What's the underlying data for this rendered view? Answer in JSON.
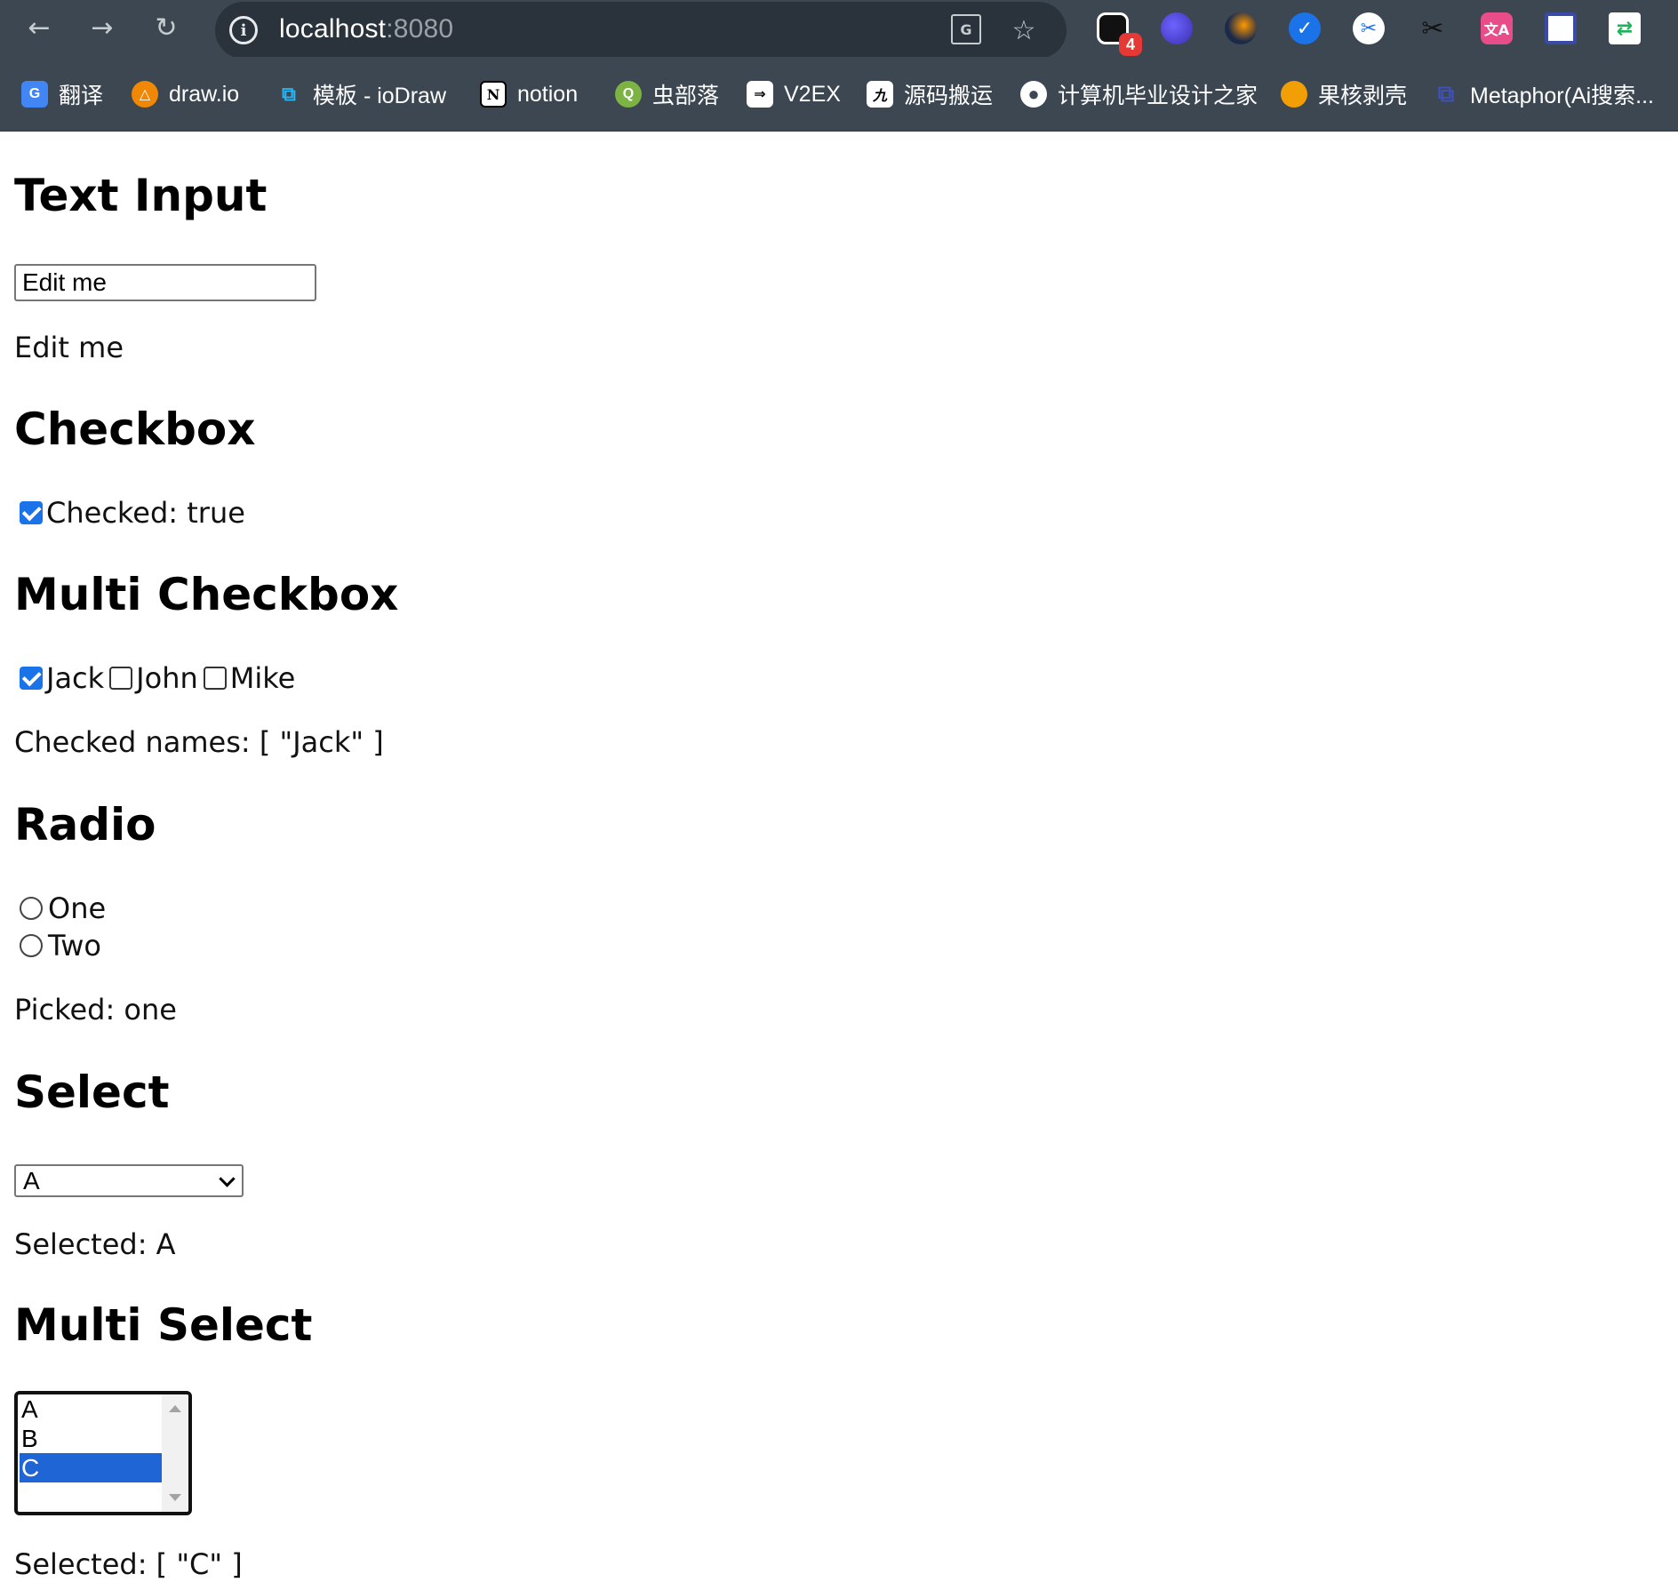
{
  "browser": {
    "url_host": "localhost",
    "url_port": ":8080",
    "extensions": [
      {
        "icon": "dark-circle-ext-icon",
        "badge": "4"
      },
      {
        "icon": "purple-swirl-ext-icon"
      },
      {
        "icon": "orange-swirl-ext-icon"
      },
      {
        "icon": "blue-check-ext-icon"
      },
      {
        "icon": "scissors-ext-icon"
      },
      {
        "icon": "cut-ext-icon"
      },
      {
        "icon": "translate-ext-icon"
      },
      {
        "icon": "window-ext-icon"
      },
      {
        "icon": "green-link-ext-icon"
      }
    ],
    "bookmarks": [
      {
        "label": "翻译",
        "icon": "google-translate-icon",
        "color": "#4285f4"
      },
      {
        "label": "draw.io",
        "icon": "drawio-icon",
        "color": "#f08705"
      },
      {
        "label": "模板 - ioDraw",
        "icon": "iodraw-icon",
        "color": "#1e88e5"
      },
      {
        "label": "notion",
        "icon": "notion-icon",
        "color": "#ffffff"
      },
      {
        "label": "虫部落",
        "icon": "chongbuluo-icon",
        "color": "#7cb342"
      },
      {
        "label": "V2EX",
        "icon": "v2ex-icon",
        "color": "#ffffff"
      },
      {
        "label": "源码搬运",
        "icon": "yuanma-icon",
        "color": "#ffffff"
      },
      {
        "label": "计算机毕业设计之家",
        "icon": "globe-icon",
        "color": "#ffffff"
      },
      {
        "label": "果核剥壳",
        "icon": "guohe-icon",
        "color": "#f29f05"
      },
      {
        "label": "Metaphor(Ai搜索...",
        "icon": "metaphor-icon",
        "color": "#3f51b5"
      }
    ]
  },
  "page": {
    "text_input": {
      "heading": "Text Input",
      "value": "Edit me",
      "echo": "Edit me"
    },
    "checkbox": {
      "heading": "Checkbox",
      "label": "Checked: true",
      "checked": true
    },
    "multi_checkbox": {
      "heading": "Multi Checkbox",
      "items": [
        {
          "label": "Jack",
          "checked": true
        },
        {
          "label": "John",
          "checked": false
        },
        {
          "label": "Mike",
          "checked": false
        }
      ],
      "summary": "Checked names: [ \"Jack\" ]"
    },
    "radio": {
      "heading": "Radio",
      "options": [
        {
          "label": "One",
          "checked": false
        },
        {
          "label": "Two",
          "checked": false
        }
      ],
      "summary": "Picked: one"
    },
    "select": {
      "heading": "Select",
      "value": "A",
      "summary": "Selected: A"
    },
    "multi_select": {
      "heading": "Multi Select",
      "options": [
        {
          "label": "A",
          "selected": false
        },
        {
          "label": "B",
          "selected": false
        },
        {
          "label": "C",
          "selected": true
        }
      ],
      "summary": "Selected: [ \"C\" ]"
    }
  },
  "colors": {
    "chrome_bg": "#3c4752",
    "omnibox_bg": "#2a333c",
    "accent_blue": "#1a73e8",
    "list_selection": "#1f65d6"
  }
}
